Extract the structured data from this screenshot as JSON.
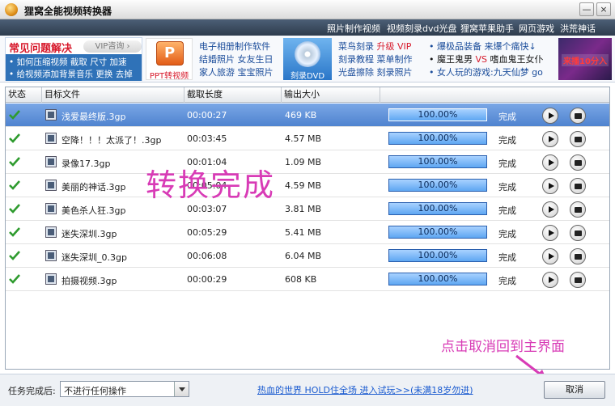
{
  "window": {
    "title": "狸窝全能视频转换器",
    "minimize": "—",
    "close": "×"
  },
  "top_links": [
    "照片制作视频",
    "视频刻录dvd光盘",
    "狸窝苹果助手",
    "网页游戏",
    "洪荒神话"
  ],
  "ads": {
    "faq_title": "常见问题解决",
    "vip_chip": "VIP咨询 ›",
    "faq_lines": [
      "• 如何压缩视频 截取 尺寸 加速",
      "• 给视频添加背景音乐 更换 去掉"
    ],
    "ppt_caption": "PPT转视频",
    "col1": [
      "电子相册制作软件",
      "结婚照片 女友生日",
      "家人旅游 宝宝照片"
    ],
    "dvd_caption": "刻录DVD",
    "col2_line1": "菜鸟刻录",
    "col2_vip": "升级 VIP",
    "col2_line2": "刻录教程 菜单制作",
    "col2_line3": "光盘擦除 刻录照片",
    "col3_line1": "• 爆极品装备 来爆个痛快↓",
    "col3_line2a": "• 魔王鬼男",
    "col3_vs": "VS",
    "col3_line2b": "嗜血鬼王女仆",
    "col3_line3": "• 女人玩的游戏:九天仙梦 go",
    "game_caption": "来播10分入"
  },
  "table": {
    "columns": [
      "状态",
      "目标文件",
      "截取长度",
      "输出大小"
    ],
    "rows": [
      {
        "file": "浅爱最终版.3gp",
        "length": "00:00:27",
        "size": "469 KB",
        "progress": "100.00%",
        "status": "完成",
        "selected": true
      },
      {
        "file": "空降！！！太派了！.3gp",
        "length": "00:03:45",
        "size": "4.57 MB",
        "progress": "100.00%",
        "status": "完成",
        "selected": false
      },
      {
        "file": "录像17.3gp",
        "length": "00:01:04",
        "size": "1.09 MB",
        "progress": "100.00%",
        "status": "完成",
        "selected": false
      },
      {
        "file": "美丽的神话.3gp",
        "length": "00:05:04",
        "size": "4.59 MB",
        "progress": "100.00%",
        "status": "完成",
        "selected": false
      },
      {
        "file": "美色杀人狂.3gp",
        "length": "00:03:07",
        "size": "3.81 MB",
        "progress": "100.00%",
        "status": "完成",
        "selected": false
      },
      {
        "file": "迷失深圳.3gp",
        "length": "00:05:29",
        "size": "5.41 MB",
        "progress": "100.00%",
        "status": "完成",
        "selected": false
      },
      {
        "file": "迷失深圳_0.3gp",
        "length": "00:06:08",
        "size": "6.04 MB",
        "progress": "100.00%",
        "status": "完成",
        "selected": false
      },
      {
        "file": "拍摄视频.3gp",
        "length": "00:00:29",
        "size": "608 KB",
        "progress": "100.00%",
        "status": "完成",
        "selected": false
      }
    ]
  },
  "overlay": {
    "done_text": "转换完成",
    "hint_text": "点击取消回到主界面"
  },
  "bottom": {
    "after_label": "任务完成后:",
    "after_value": "不进行任何操作",
    "promo": "热血的世界 HOLD住全场 进入试玩>>(未满18岁勿进)",
    "cancel_label": "取消"
  },
  "colors": {
    "accent": "#2f72b8",
    "selected_row": "#4f83cf",
    "annotation": "#d83bb6"
  }
}
